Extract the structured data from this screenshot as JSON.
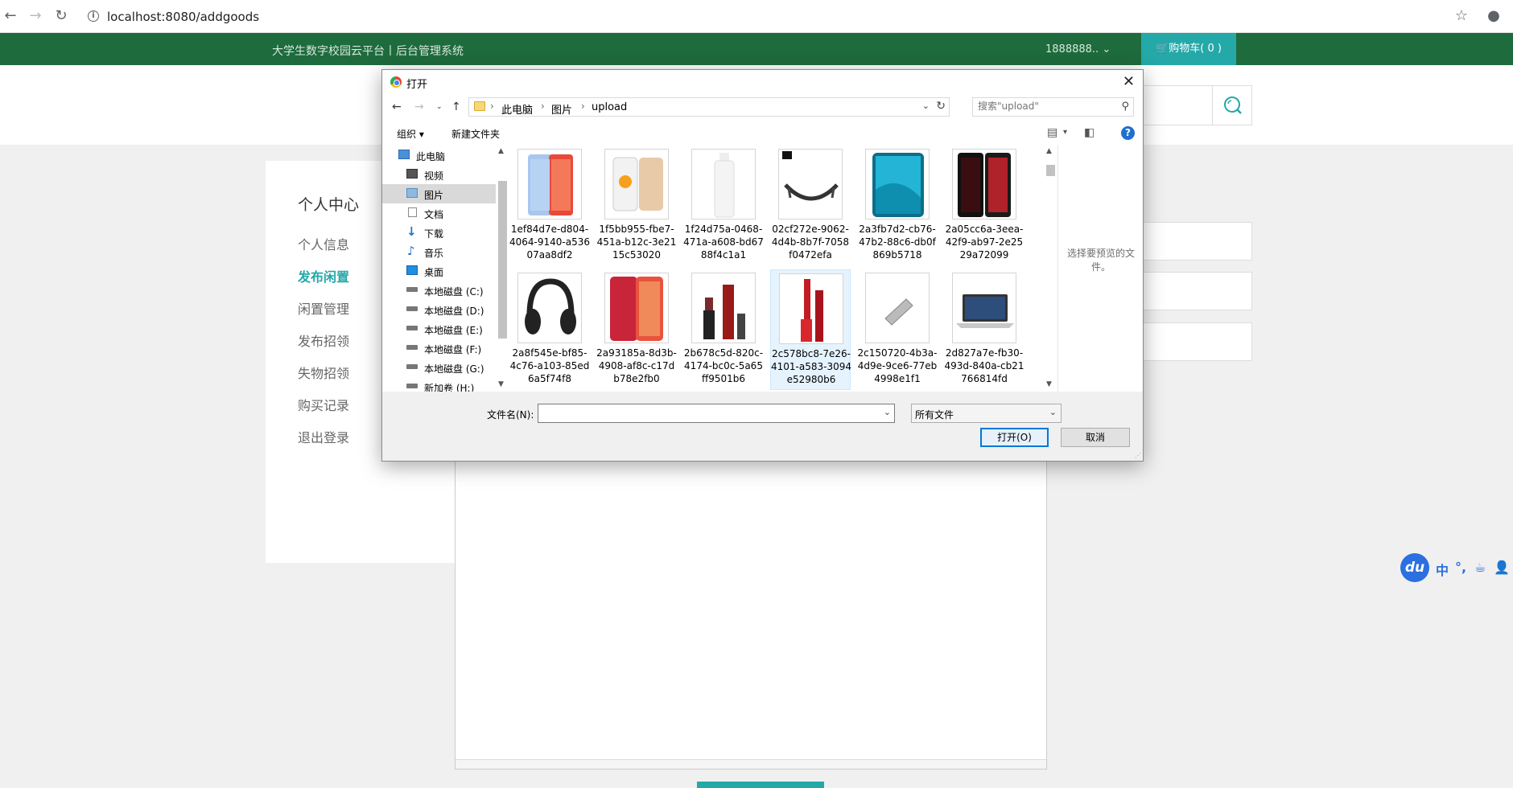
{
  "browser": {
    "url": "localhost:8080/addgoods"
  },
  "site": {
    "title": "大学生数字校园云平台丨后台管理系统",
    "user": "1888888..",
    "cart": "购物车( 0 )"
  },
  "sidebar": {
    "title": "个人中心",
    "items": [
      {
        "label": "个人信息",
        "active": false
      },
      {
        "label": "发布闲置",
        "active": true
      },
      {
        "label": "闲置管理",
        "active": false
      },
      {
        "label": "发布招领",
        "active": false
      },
      {
        "label": "失物招领",
        "active": false
      },
      {
        "label": "购买记录",
        "active": false
      },
      {
        "label": "退出登录",
        "active": false
      }
    ]
  },
  "ime": {
    "logo": "du",
    "symbols": [
      "中",
      "°,",
      "☕",
      "👤"
    ]
  },
  "dialog": {
    "title": "打开",
    "path": [
      "此电脑",
      "图片",
      "upload"
    ],
    "search_placeholder": "搜索\"upload\"",
    "toolbar": {
      "organize": "组织 ▾",
      "new_folder": "新建文件夹"
    },
    "nav": [
      {
        "label": "此电脑",
        "icon": "computer-icon",
        "indent": 0
      },
      {
        "label": "视频",
        "icon": "video-folder-icon",
        "indent": 1
      },
      {
        "label": "图片",
        "icon": "pictures-folder-icon",
        "indent": 1,
        "selected": true
      },
      {
        "label": "文档",
        "icon": "documents-folder-icon",
        "indent": 1
      },
      {
        "label": "下载",
        "icon": "download-icon",
        "indent": 1
      },
      {
        "label": "音乐",
        "icon": "music-icon",
        "indent": 1
      },
      {
        "label": "桌面",
        "icon": "desktop-icon",
        "indent": 1
      },
      {
        "label": "本地磁盘 (C:)",
        "icon": "drive-icon",
        "indent": 1
      },
      {
        "label": "本地磁盘 (D:)",
        "icon": "drive-icon",
        "indent": 1
      },
      {
        "label": "本地磁盘 (E:)",
        "icon": "drive-icon",
        "indent": 1
      },
      {
        "label": "本地磁盘 (F:)",
        "icon": "drive-icon",
        "indent": 1
      },
      {
        "label": "本地磁盘 (G:)",
        "icon": "drive-icon",
        "indent": 1
      },
      {
        "label": "新加卷 (H:)",
        "icon": "drive-icon",
        "indent": 1
      }
    ],
    "files": [
      {
        "name": "1ef84d7e-d804-4064-9140-a53607aa8df2",
        "thumb": "phone-blue"
      },
      {
        "name": "1f5bb955-fbe7-451a-b12c-3e2115c53020",
        "thumb": "phone-gold"
      },
      {
        "name": "1f24d75a-0468-471a-a608-bd6788f4c1a1",
        "thumb": "bottle"
      },
      {
        "name": "02cf272e-9062-4d4b-8b7f-7058f0472efa",
        "thumb": "earphones"
      },
      {
        "name": "2a3fb7d2-cb76-47b2-88c6-db0f869b5718",
        "thumb": "phone-teal"
      },
      {
        "name": "2a05cc6a-3eea-42f9-ab97-2e2529a72099",
        "thumb": "phone-dark"
      },
      {
        "name": "2a8f545e-bf85-4c76-a103-85ed6a5f74f8",
        "thumb": "headphones"
      },
      {
        "name": "2a93185a-8d3b-4908-af8c-c17db78e2fb0",
        "thumb": "phone-red"
      },
      {
        "name": "2b678c5d-820c-4174-bc0c-5a65ff9501b6",
        "thumb": "lipstick-dark"
      },
      {
        "name": "2c578bc8-7e26-4101-a583-3094e52980b6",
        "thumb": "lipstick-red"
      },
      {
        "name": "2c150720-4b3a-4d9e-9ce6-77eb4998e1f1",
        "thumb": "usb"
      },
      {
        "name": "2d827a7e-fb30-493d-840a-cb21766814fd",
        "thumb": "laptop"
      }
    ],
    "preview_text": "选择要预览的文件。",
    "filename_label": "文件名(N):",
    "filename_value": "",
    "filter": "所有文件",
    "open_button": "打开(O)",
    "cancel_button": "取消"
  }
}
